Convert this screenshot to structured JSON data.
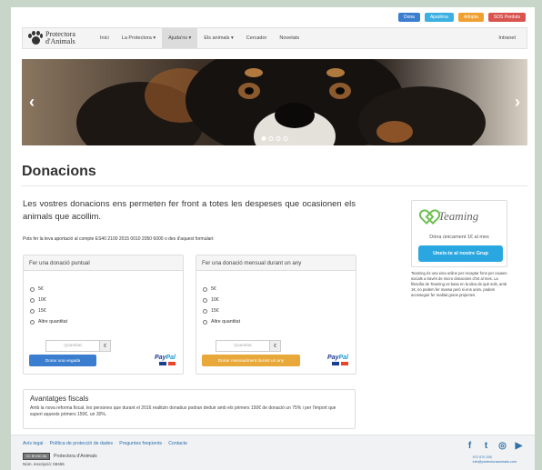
{
  "top_buttons": [
    {
      "label": "Dona",
      "color": "#3b7ecf"
    },
    {
      "label": "Apadrina",
      "color": "#3cb0e3"
    },
    {
      "label": "Adopta",
      "color": "#f0a030"
    },
    {
      "label": "SOS Perduts",
      "color": "#d9534f"
    }
  ],
  "brand": {
    "line1": "Protectora",
    "line2": "d'Animals"
  },
  "nav": {
    "items": [
      "Inici",
      "La Protectora ▾",
      "Ajuda'ns ▾",
      "Els animals ▾",
      "Cercador",
      "Novetats"
    ],
    "right": "Intranet"
  },
  "hero": {
    "prev": "‹",
    "next": "›"
  },
  "page_title": "Donacions",
  "lead": "Les vostres donacions ens permeten fer front a totes les despeses que ocasionen els animals que acollim.",
  "account_text": "Pots fer la teva aportació al compte ES40 2100 2015 0010 2050 6000 o des d'aquest formulari:",
  "panels": [
    {
      "heading": "Fer una donació puntual",
      "options": [
        "5€",
        "10€",
        "15€",
        "Altre quantitat"
      ],
      "quantity_placeholder": "Quantitat",
      "currency": "€",
      "button": "Donar una vegada",
      "button_color": "#3b7ecf",
      "paypal": {
        "pay": "Pay",
        "pal": "Pal"
      }
    },
    {
      "heading": "Fer una donació mensual durant un any",
      "options": [
        "5€",
        "10€",
        "15€",
        "Altre quantitat"
      ],
      "quantity_placeholder": "Quantitat",
      "currency": "€",
      "button": "Donar mensualment durant un any",
      "button_color": "#e9a93a",
      "paypal": {
        "pay": "Pay",
        "pal": "Pal"
      }
    }
  ],
  "fiscal": {
    "heading": "Avantatges fiscals",
    "body": "Amb la nova reforma fiscal, les persones que durant el 2016 realitzin donatius podran deduir amb els primers 150€ de donació un 75% i per l'import que superi aquests primers 150€, un 30%."
  },
  "teaming": {
    "logo": "Teaming",
    "subtitle": "Dóna únicament 1€ al mes",
    "button": "Uneix-te al nostre Grup",
    "description": "Teaming és una eina online per recaptar fons per causes socials a través de micro donacions d'1€ al mes. La filosofia de Teaming es basa en la idea de què sols, amb 1€, no podem fer massa però si ens unim, podem aconseguir fer realitat grans projectes."
  },
  "footer": {
    "links": [
      "Avís legal",
      "Política de protecció de dades",
      "Preguntes freqüents",
      "Contacte"
    ],
    "license_badge": "CC BY-NC-SA",
    "org": "Protectora d'Animals",
    "registration": "Núm. inscripció: 59465",
    "social": [
      {
        "icon": "facebook-icon",
        "glyph": "f"
      },
      {
        "icon": "twitter-icon",
        "glyph": "t"
      },
      {
        "icon": "instagram-icon",
        "glyph": "◎"
      },
      {
        "icon": "youtube-icon",
        "glyph": "▶"
      }
    ],
    "contact": [
      "972 570 155",
      "info@protectoraanimals.com"
    ]
  }
}
